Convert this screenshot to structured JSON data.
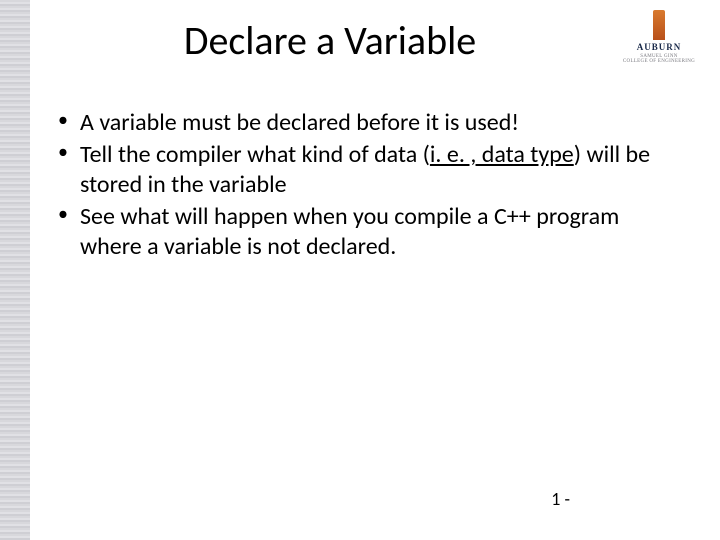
{
  "logo": {
    "name": "AUBURN",
    "line1": "SAMUEL GINN",
    "line2": "COLLEGE OF ENGINEERING"
  },
  "title": "Declare a Variable",
  "bullets": {
    "b1": "A variable must be declared before it is used!",
    "b2a": "Tell the compiler what kind of data (",
    "b2b": "i. e. , data type",
    "b2c": ") will be stored in the variable",
    "b3": "See what will happen when you compile a C++ program where a variable is not declared."
  },
  "page_number": "1 -"
}
